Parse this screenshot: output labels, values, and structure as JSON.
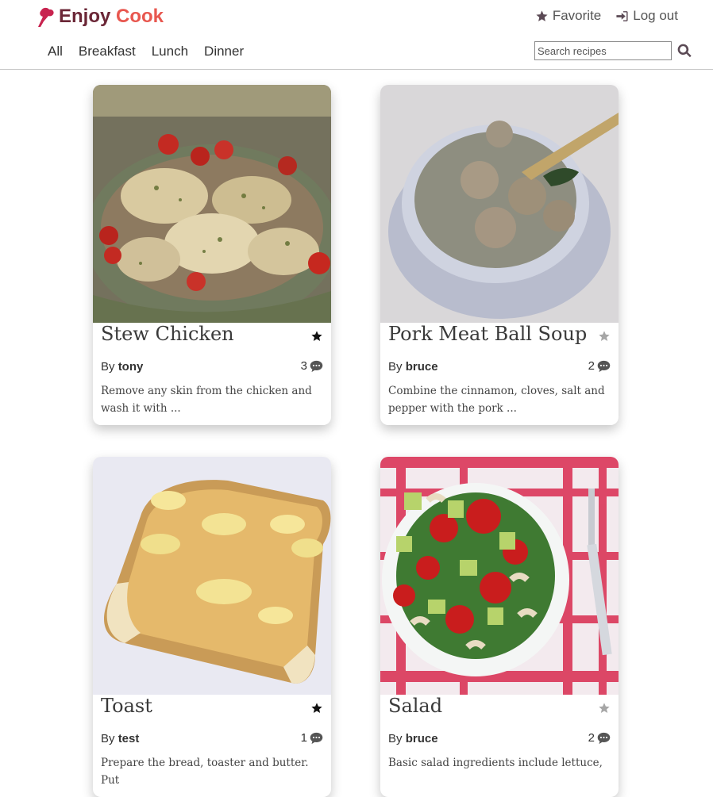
{
  "brand": {
    "part1": "Enjoy",
    "part2": "Cook"
  },
  "top_actions": {
    "favorite": "Favorite",
    "logout": "Log out"
  },
  "nav": {
    "items": [
      "All",
      "Breakfast",
      "Lunch",
      "Dinner"
    ]
  },
  "search": {
    "placeholder": "Search recipes"
  },
  "colors": {
    "brand_dark": "#6b2737",
    "brand_accent": "#e8574f",
    "logo": "#c8234f"
  },
  "recipes": [
    {
      "title": "Stew Chicken",
      "author": "tony",
      "comments": "3",
      "favorited": true,
      "description": "Remove any skin from the chicken and wash it with ...",
      "image": "photo of stewed chicken with tomatoes in a slow cooker"
    },
    {
      "title": "Pork Meat Ball Soup",
      "author": "bruce",
      "comments": "2",
      "favorited": false,
      "description": "Combine the cinnamon, cloves, salt and pepper with the pork ...",
      "image": "photo of meatball soup in a white bowl"
    },
    {
      "title": "Toast",
      "author": "test",
      "comments": "1",
      "favorited": true,
      "description": "Prepare the bread, toaster and butter. Put",
      "image": "photo of buttered toast"
    },
    {
      "title": "Salad",
      "author": "bruce",
      "comments": "2",
      "favorited": false,
      "description": "Basic salad ingredients include lettuce,",
      "image": "photo of salad with tomatoes, avocado and cashews"
    }
  ],
  "labels": {
    "by": "By"
  }
}
